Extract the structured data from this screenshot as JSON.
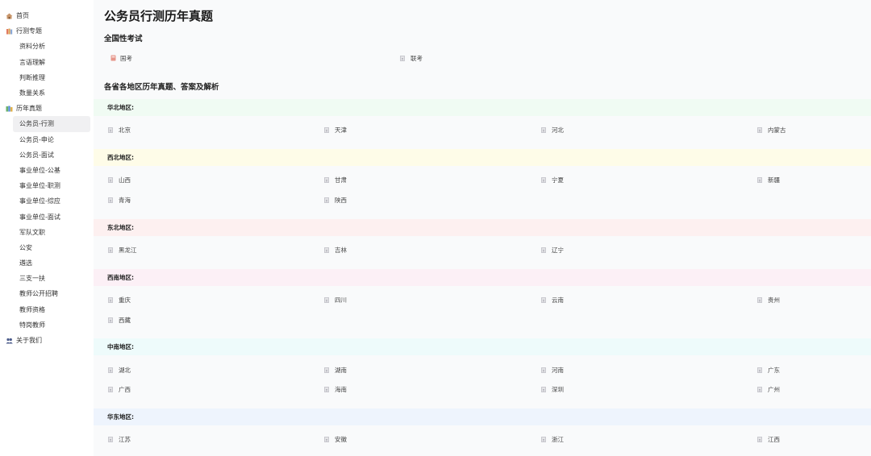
{
  "sidebar": {
    "home": "首页",
    "topics": "行测专题",
    "topic_items": [
      "资料分析",
      "言语理解",
      "判断推理",
      "数量关系"
    ],
    "past_papers": "历年真题",
    "paper_items": [
      "公务员-行测",
      "公务员-申论",
      "公务员-面试",
      "事业单位-公基",
      "事业单位-职测",
      "事业单位-综应",
      "事业单位-面试",
      "军队文职",
      "公安",
      "遴选",
      "三支一扶",
      "教师公开招聘",
      "教师资格",
      "特岗教师"
    ],
    "about": "关于我们"
  },
  "main": {
    "title": "公务员行测历年真题",
    "national_title": "全国性考试",
    "national_items": [
      "国考",
      "联考"
    ],
    "regions_title": "各省各地区历年真题、答案及解析",
    "regions": [
      {
        "name": "华北地区:",
        "color": "#f0fbf3",
        "items": [
          "北京",
          "天津",
          "河北",
          "内蒙古"
        ]
      },
      {
        "name": "西北地区:",
        "color": "#fefce8",
        "items": [
          "山西",
          "甘肃",
          "宁夏",
          "新疆",
          "青海",
          "陕西"
        ]
      },
      {
        "name": "东北地区:",
        "color": "#fdf0f0",
        "items": [
          "黑龙江",
          "吉林",
          "辽宁"
        ]
      },
      {
        "name": "西南地区:",
        "color": "#fcf0f6",
        "items": [
          "重庆",
          "四川",
          "云南",
          "贵州",
          "西藏"
        ]
      },
      {
        "name": "中南地区:",
        "color": "#eefbfb",
        "items": [
          "湖北",
          "湖南",
          "河南",
          "广东",
          "广西",
          "海南",
          "深圳",
          "广州"
        ]
      },
      {
        "name": "华东地区:",
        "color": "#eef4fd",
        "items": [
          "江苏",
          "安徽",
          "浙江",
          "江西"
        ]
      }
    ]
  }
}
